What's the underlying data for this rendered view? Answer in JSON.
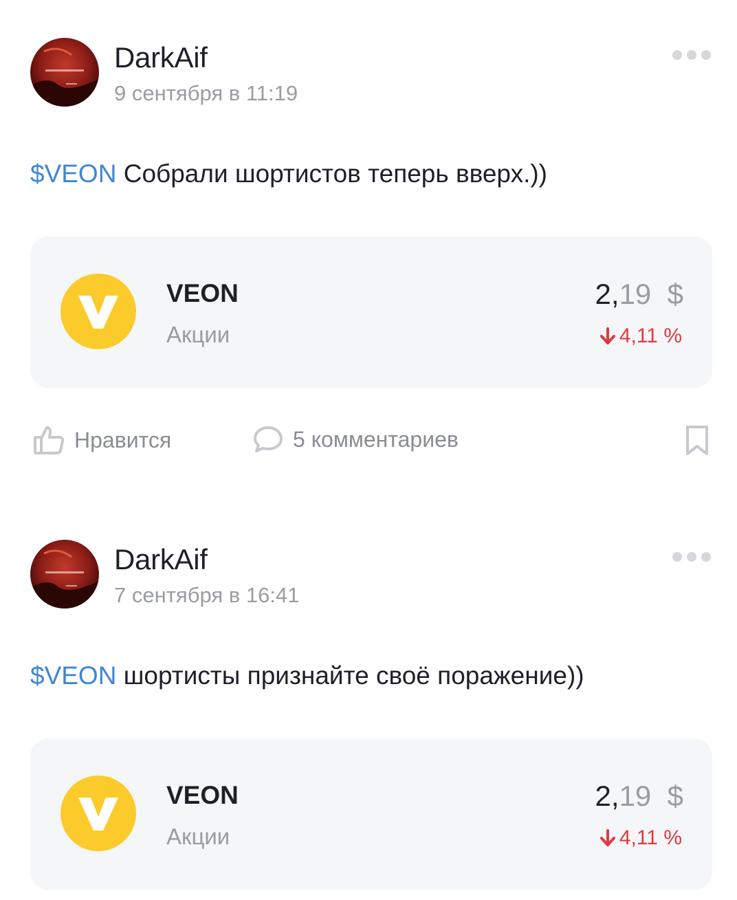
{
  "posts": [
    {
      "author": "DarkAif",
      "date": "9 сентября в 11:19",
      "ticker": "$VEON",
      "text": " Собрали шортистов теперь вверх.))",
      "card": {
        "name": "VEON",
        "type": "Акции",
        "price_int": "2,",
        "price_frac": "19",
        "currency": "$",
        "change": "4,11 %"
      },
      "actions": {
        "like_label": "Нравится",
        "comments_label": "5 комментариев"
      }
    },
    {
      "author": "DarkAif",
      "date": "7 сентября в 16:41",
      "ticker": "$VEON",
      "text": " шортисты признайте своё поражение))",
      "card": {
        "name": "VEON",
        "type": "Акции",
        "price_int": "2,",
        "price_frac": "19",
        "currency": "$",
        "change": "4,11 %"
      }
    }
  ],
  "colors": {
    "link": "#3f86d4",
    "negative": "#e0393e",
    "brand_yellow": "#fbcb2c"
  },
  "icons": [
    "more-icon",
    "veon-logo-icon",
    "arrow-down-icon",
    "like-icon",
    "comment-icon",
    "bookmark-icon"
  ]
}
